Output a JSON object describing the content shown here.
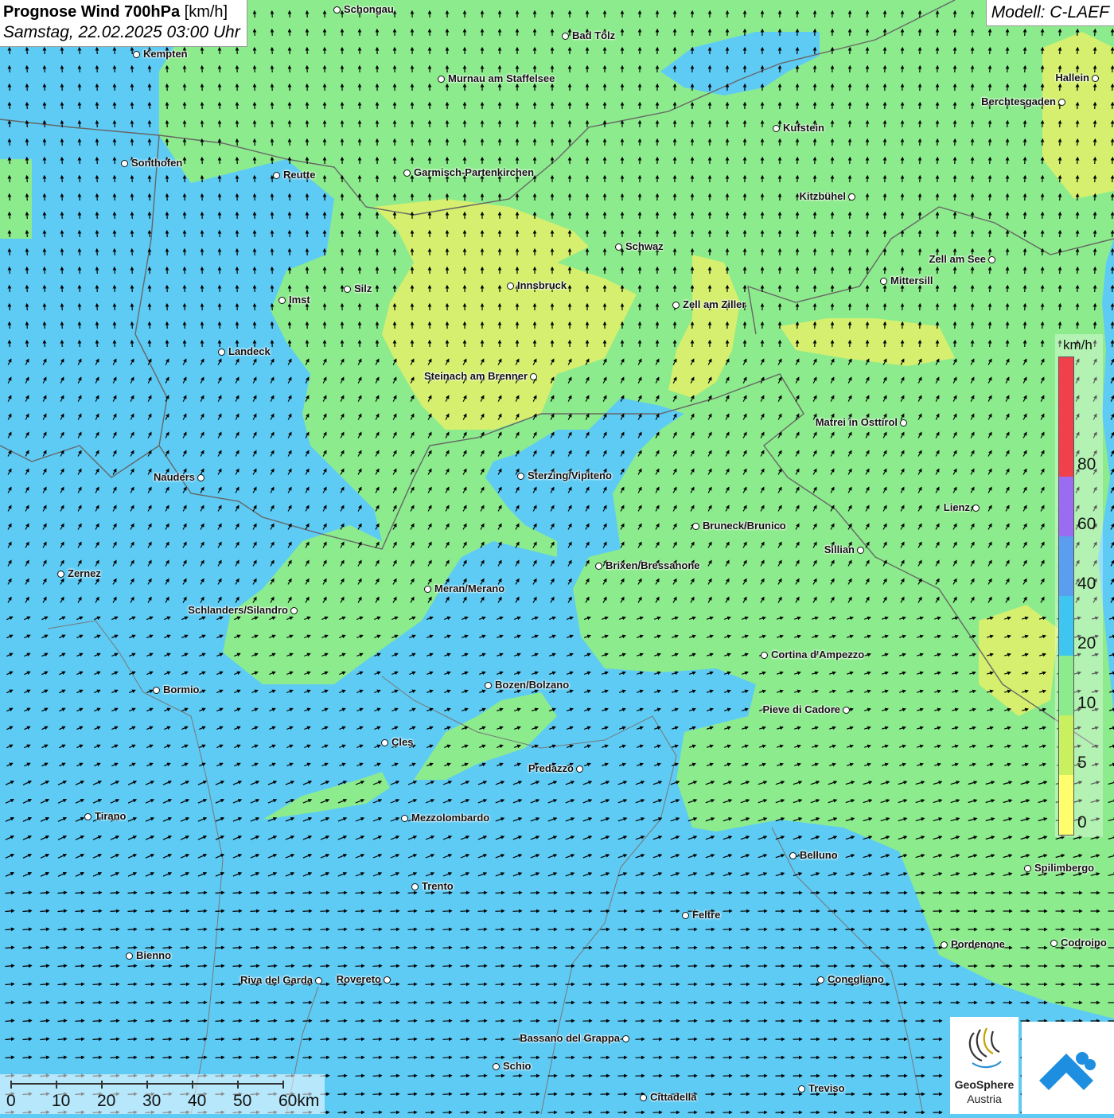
{
  "header": {
    "title_bold": "Prognose Wind 700hPa",
    "title_unit": "[km/h]",
    "datetime": "Samstag, 22.02.2025 03:00 Uhr",
    "model": "Modell: C-LAEF"
  },
  "legend": {
    "unit": "km/h",
    "classes": [
      {
        "label": "0",
        "color": "#ffff6e"
      },
      {
        "label": "5",
        "color": "#c9f05e"
      },
      {
        "label": "10",
        "color": "#8ceb8c"
      },
      {
        "label": "20",
        "color": "#3ec6f0"
      },
      {
        "label": "40",
        "color": "#5a9ef0"
      },
      {
        "label": "60",
        "color": "#9a6cf0"
      },
      {
        "label": "80",
        "color": "#f0404c"
      }
    ],
    "top_color": "#f0404c"
  },
  "scalebar": {
    "labels": [
      "0",
      "10",
      "20",
      "30",
      "40",
      "50",
      "60km"
    ]
  },
  "cities": [
    {
      "name": "Schongau"
    },
    {
      "name": "Bad Tölz"
    },
    {
      "name": "Kempten"
    },
    {
      "name": "Murnau am Staffelsee"
    },
    {
      "name": "Hallein"
    },
    {
      "name": "Berchtesgaden"
    },
    {
      "name": "Kufstein"
    },
    {
      "name": "Sonthofen"
    },
    {
      "name": "Reutte"
    },
    {
      "name": "Garmisch-Partenkirchen"
    },
    {
      "name": "Kitzbühel"
    },
    {
      "name": "Schwaz"
    },
    {
      "name": "Zell am See"
    },
    {
      "name": "Mittersill"
    },
    {
      "name": "Imst"
    },
    {
      "name": "Silz"
    },
    {
      "name": "Innsbruck"
    },
    {
      "name": "Zell am Ziller"
    },
    {
      "name": "Landeck"
    },
    {
      "name": "Steinach am Brenner"
    },
    {
      "name": "Matrei in Osttirol"
    },
    {
      "name": "Nauders"
    },
    {
      "name": "Sterzing/Vipiteno"
    },
    {
      "name": "Lienz"
    },
    {
      "name": "Bruneck/Brunico"
    },
    {
      "name": "Sillian"
    },
    {
      "name": "Zernez"
    },
    {
      "name": "Brixen/Bressanone"
    },
    {
      "name": "Meran/Merano"
    },
    {
      "name": "Schlanders/Silandro"
    },
    {
      "name": "Cortina d'Ampezzo"
    },
    {
      "name": "Bozen/Bolzano"
    },
    {
      "name": "Bormio"
    },
    {
      "name": "Pieve di Cadore"
    },
    {
      "name": "Cles"
    },
    {
      "name": "Predazzo"
    },
    {
      "name": "Tirano"
    },
    {
      "name": "Mezzolombardo"
    },
    {
      "name": "Belluno"
    },
    {
      "name": "Spilimbergo"
    },
    {
      "name": "Trento"
    },
    {
      "name": "Feltre"
    },
    {
      "name": "Pordenone"
    },
    {
      "name": "Codroipo"
    },
    {
      "name": "Bienno"
    },
    {
      "name": "Riva del Garda"
    },
    {
      "name": "Rovereto"
    },
    {
      "name": "Conegliano"
    },
    {
      "name": "Bassano del Grappa"
    },
    {
      "name": "Schio"
    },
    {
      "name": "Treviso"
    },
    {
      "name": "Cittadella"
    }
  ],
  "logos": {
    "geosphere_name": "GeoSphere",
    "geosphere_sub": "Austria"
  },
  "colors": {
    "calm_yellow": "#f2f080",
    "light_green": "#8ceb8c",
    "cyan": "#5ecbf5",
    "arrow": "#000000"
  }
}
